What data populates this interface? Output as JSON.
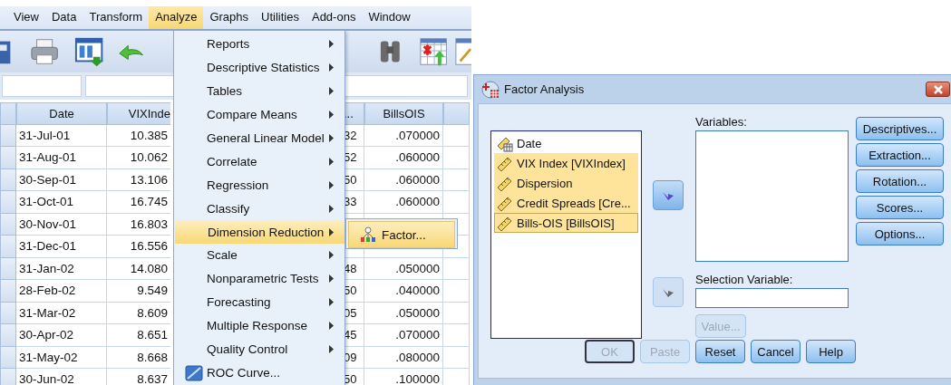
{
  "menubar": [
    {
      "label": "View",
      "selected": false
    },
    {
      "label": "Data",
      "selected": false
    },
    {
      "label": "Transform",
      "selected": false
    },
    {
      "label": "Analyze",
      "selected": true
    },
    {
      "label": "Graphs",
      "selected": false
    },
    {
      "label": "Utilities",
      "selected": false
    },
    {
      "label": "Add-ons",
      "selected": false
    },
    {
      "label": "Window",
      "selected": false
    }
  ],
  "grid": {
    "columns": [
      "Date",
      "VIXInde",
      "...",
      "BillsOIS"
    ],
    "rows": [
      {
        "date": "31-Jul-01",
        "vix": "10.385",
        "col3": "32",
        "bills": ".070000"
      },
      {
        "date": "31-Aug-01",
        "vix": "10.062",
        "col3": "52",
        "bills": ".060000"
      },
      {
        "date": "30-Sep-01",
        "vix": "13.106",
        "col3": "50",
        "bills": ".060000"
      },
      {
        "date": "31-Oct-01",
        "vix": "16.745",
        "col3": "33",
        "bills": ".060000"
      },
      {
        "date": "30-Nov-01",
        "vix": "16.803"
      },
      {
        "date": "31-Dec-01",
        "vix": "16.556"
      },
      {
        "date": "31-Jan-02",
        "vix": "14.080",
        "col3": "48",
        "bills": ".050000"
      },
      {
        "date": "28-Feb-02",
        "vix": "9.549",
        "col3": "50",
        "bills": ".040000"
      },
      {
        "date": "31-Mar-02",
        "vix": "8.609",
        "col3": "05",
        "bills": ".050000"
      },
      {
        "date": "30-Apr-02",
        "vix": "8.651",
        "col3": "45",
        "bills": ".070000"
      },
      {
        "date": "31-May-02",
        "vix": "8.668",
        "col3": "09",
        "bills": ".080000"
      },
      {
        "date": "30-Jun-02",
        "vix": "8.637",
        "col3": "50",
        "bills": ".100000"
      }
    ]
  },
  "menu": {
    "items": [
      {
        "label": "Reports",
        "kind": "submenu",
        "selected": false
      },
      {
        "label": "Descriptive Statistics",
        "kind": "submenu",
        "selected": false
      },
      {
        "label": "Tables",
        "kind": "submenu",
        "selected": false
      },
      {
        "label": "Compare Means",
        "kind": "submenu",
        "selected": false
      },
      {
        "label": "General Linear Model",
        "kind": "submenu",
        "selected": false
      },
      {
        "label": "Correlate",
        "kind": "submenu",
        "selected": false
      },
      {
        "label": "Regression",
        "kind": "submenu",
        "selected": false
      },
      {
        "label": "Classify",
        "kind": "submenu",
        "selected": false
      },
      {
        "label": "Dimension Reduction",
        "kind": "submenu",
        "selected": true
      },
      {
        "label": "Scale",
        "kind": "submenu",
        "selected": false
      },
      {
        "label": "Nonparametric Tests",
        "kind": "submenu",
        "selected": false
      },
      {
        "label": "Forecasting",
        "kind": "submenu",
        "selected": false
      },
      {
        "label": "Multiple Response",
        "kind": "submenu",
        "selected": false
      },
      {
        "label": "Quality Control",
        "kind": "submenu",
        "selected": false
      },
      {
        "label": "ROC Curve...",
        "kind": "command",
        "selected": false
      }
    ]
  },
  "submenu": {
    "items": [
      {
        "label": "Factor...",
        "selected": true
      }
    ]
  },
  "dialog": {
    "title": "Factor Analysis",
    "source_list": [
      {
        "label": "Date",
        "kind": "date",
        "selected": false
      },
      {
        "label": "VIX Index [VIXIndex]",
        "kind": "scale",
        "selected": true
      },
      {
        "label": "Dispersion",
        "kind": "scale",
        "selected": true
      },
      {
        "label": "Credit Spreads [Cre...",
        "kind": "scale",
        "selected": true
      },
      {
        "label": "Bills-OIS [BillsOIS]",
        "kind": "scale",
        "selected": true
      }
    ],
    "variables_label": "Variables:",
    "move_buttons": [
      {
        "disabled": false
      },
      {
        "disabled": true
      }
    ],
    "side_buttons": [
      {
        "label": "Descriptives..."
      },
      {
        "label": "Extraction..."
      },
      {
        "label": "Rotation..."
      },
      {
        "label": "Scores..."
      },
      {
        "label": "Options..."
      }
    ],
    "selection_label": "Selection Variable:",
    "value_button": {
      "label": "Value...",
      "disabled": true
    },
    "buttons": [
      {
        "label": "OK",
        "disabled": true
      },
      {
        "label": "Paste",
        "disabled": true
      },
      {
        "label": "Reset",
        "disabled": false
      },
      {
        "label": "Cancel",
        "disabled": false
      },
      {
        "label": "Help",
        "disabled": false
      }
    ]
  }
}
